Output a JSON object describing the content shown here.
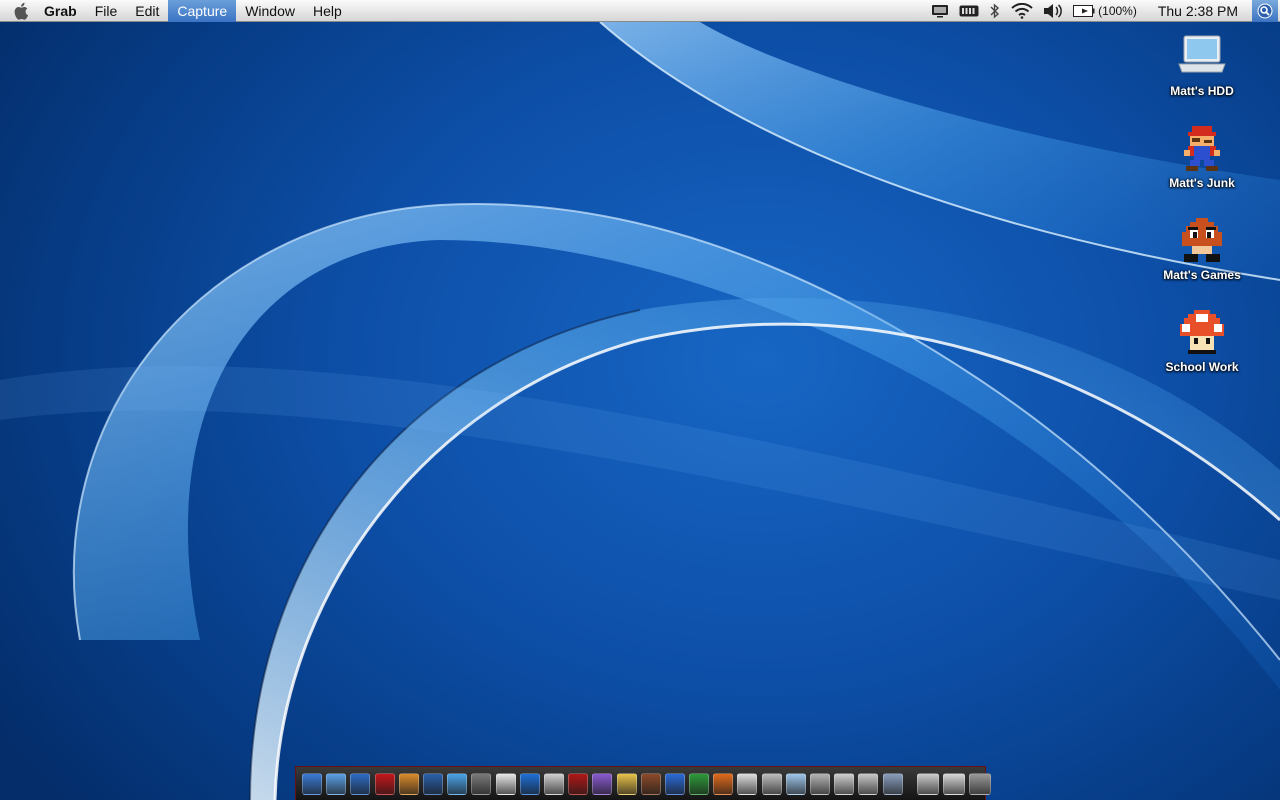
{
  "menubar": {
    "apple_icon": "apple-logo-icon",
    "app_name": "Grab",
    "menus": [
      "File",
      "Edit",
      "Capture",
      "Window",
      "Help"
    ],
    "active_menu": "Capture",
    "status": {
      "display_icon": "display-mirroring-icon",
      "keyboard_icon": "input-menu-icon",
      "bluetooth_icon": "bluetooth-icon",
      "wifi_icon": "wifi-icon",
      "volume_icon": "volume-icon",
      "battery_icon": "battery-icon",
      "battery_percent": "(100%)",
      "clock": "Thu 2:38 PM",
      "spotlight_icon": "spotlight-search-icon"
    }
  },
  "desktop": {
    "icons": [
      {
        "label": "Matt's HDD",
        "icon": "laptop-drive-icon"
      },
      {
        "label": "Matt's Junk",
        "icon": "mario-sprite-icon"
      },
      {
        "label": "Matt's Games",
        "icon": "goomba-sprite-icon"
      },
      {
        "label": "School Work",
        "icon": "mushroom-sprite-icon"
      }
    ]
  },
  "dock": {
    "apps": [
      {
        "name": "finder-icon",
        "color": "#3a7bd5"
      },
      {
        "name": "safari-icon",
        "color": "#5aa0e6"
      },
      {
        "name": "compass-icon",
        "color": "#2e6bc4"
      },
      {
        "name": "opera-icon",
        "color": "#c4161c"
      },
      {
        "name": "photos-icon",
        "color": "#d98b2b"
      },
      {
        "name": "clapper-icon",
        "color": "#2a5fa8"
      },
      {
        "name": "itunes-icon",
        "color": "#4aa3e8"
      },
      {
        "name": "garageband-icon",
        "color": "#7a7a7a"
      },
      {
        "name": "ical-icon",
        "color": "#e8e8e8"
      },
      {
        "name": "quicktime-icon",
        "color": "#1e6fd6"
      },
      {
        "name": "ipod-icon",
        "color": "#cfcfcf"
      },
      {
        "name": "red-app-icon",
        "color": "#b01818"
      },
      {
        "name": "comic-app-icon",
        "color": "#8a5ad0"
      },
      {
        "name": "pencil-app-icon",
        "color": "#e8c24a"
      },
      {
        "name": "brush-app-icon",
        "color": "#8b4a2a"
      },
      {
        "name": "word-icon",
        "color": "#2b6ad6"
      },
      {
        "name": "excel-icon",
        "color": "#2e9a3a"
      },
      {
        "name": "powerpoint-icon",
        "color": "#e06a1c"
      },
      {
        "name": "textedit-icon",
        "color": "#dedede"
      },
      {
        "name": "printer-icon",
        "color": "#bdbdbd"
      },
      {
        "name": "preview-icon",
        "color": "#9ec6ea"
      },
      {
        "name": "package-icon",
        "color": "#b5b5b5"
      },
      {
        "name": "utility-icon",
        "color": "#d0d0d0"
      },
      {
        "name": "image-app-icon",
        "color": "#c8c8c8"
      },
      {
        "name": "system-preferences-icon",
        "color": "#8a9fbf"
      }
    ],
    "right_items": [
      {
        "name": "downloads-stack-icon",
        "color": "#cccccc"
      },
      {
        "name": "documents-stack-icon",
        "color": "#d8d8d8"
      },
      {
        "name": "trash-icon",
        "color": "#9a9a9a"
      }
    ]
  }
}
